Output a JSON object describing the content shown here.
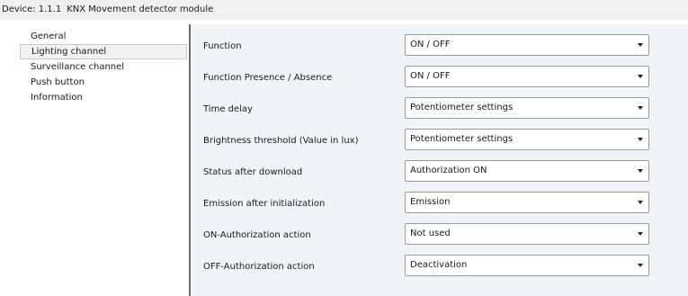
{
  "titlebar": {
    "device_label": "Device: 1.1.1",
    "device_name": "KNX Movement detector module"
  },
  "sidebar": {
    "items": [
      {
        "label": "General"
      },
      {
        "label": "Lighting channel"
      },
      {
        "label": "Surveillance channel"
      },
      {
        "label": "Push button"
      },
      {
        "label": "Information"
      }
    ],
    "selected_index": 1
  },
  "settings": [
    {
      "label": "Function",
      "value": "ON / OFF"
    },
    {
      "label": "Function Presence / Absence",
      "value": "ON / OFF"
    },
    {
      "label": "Time delay",
      "value": "Potentiometer settings"
    },
    {
      "label": "Brightness threshold (Value in lux)",
      "value": "Potentiometer settings"
    },
    {
      "label": "Status after download",
      "value": "Authorization ON"
    },
    {
      "label": "Emission after initialization",
      "value": "Emission"
    },
    {
      "label": "ON-Authorization action",
      "value": "Not used"
    },
    {
      "label": "OFF-Authorization action",
      "value": "Deactivation"
    }
  ],
  "icons": {
    "dropdown": "chevron-down-icon"
  },
  "colors": {
    "content_bg": "#f0f4f8",
    "selected_bg": "#f2f2f2",
    "divider": "#6b6b6b"
  }
}
